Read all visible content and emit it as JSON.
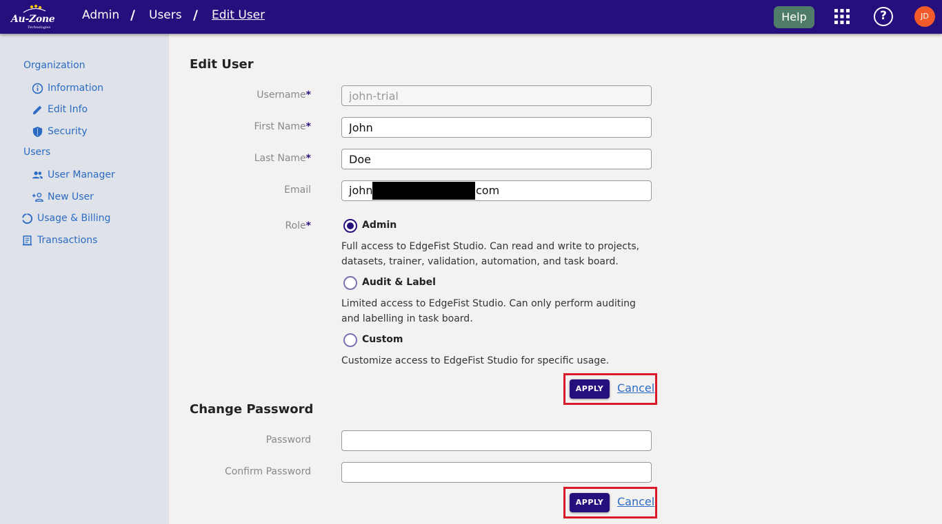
{
  "brand": {
    "logo_text": "Au-Zone",
    "logo_sub": "Technologies"
  },
  "breadcrumb": [
    {
      "label": "Admin"
    },
    {
      "label": "Users"
    },
    {
      "label": "Edit User"
    }
  ],
  "breadcrumb_separator": "/",
  "header": {
    "help_label": "Help",
    "question_glyph": "?",
    "avatar_initials": "JD"
  },
  "sidebar": {
    "organization": "Organization",
    "information": "Information",
    "edit_info": "Edit Info",
    "security": "Security",
    "users": "Users",
    "user_manager": "User Manager",
    "new_user": "New User",
    "usage_billing": "Usage & Billing",
    "transactions": "Transactions"
  },
  "edit_user": {
    "title": "Edit User",
    "username_label": "Username",
    "username_value": "john-trial",
    "first_name_label": "First Name",
    "first_name_value": "John",
    "last_name_label": "Last Name",
    "last_name_value": "Doe",
    "email_label": "Email",
    "email_prefix": "john",
    "email_suffix": "com",
    "role_label": "Role",
    "required_mark": "*",
    "roles": [
      {
        "label": "Admin",
        "checked": true,
        "description": "Full access to EdgeFist Studio. Can read and write to projects, datasets, trainer, validation, automation, and task board."
      },
      {
        "label": "Audit & Label",
        "checked": false,
        "description": "Limited access to EdgeFist Studio. Can only perform auditing and labelling in task board."
      },
      {
        "label": "Custom",
        "checked": false,
        "description": "Customize access to EdgeFist Studio for specific usage."
      }
    ],
    "apply_label": "APPLY",
    "cancel_label": "Cancel"
  },
  "change_password": {
    "title": "Change Password",
    "password_label": "Password",
    "password_value": "",
    "confirm_label": "Confirm Password",
    "confirm_value": "",
    "apply_label": "APPLY",
    "cancel_label": "Cancel"
  },
  "colors": {
    "header_bg": "#260f7c",
    "sidebar_bg": "#dfe2e8",
    "link": "#2b6bc4",
    "help_button": "#4e7c69",
    "avatar": "#f25a29",
    "highlight_box": "#d9192a"
  }
}
